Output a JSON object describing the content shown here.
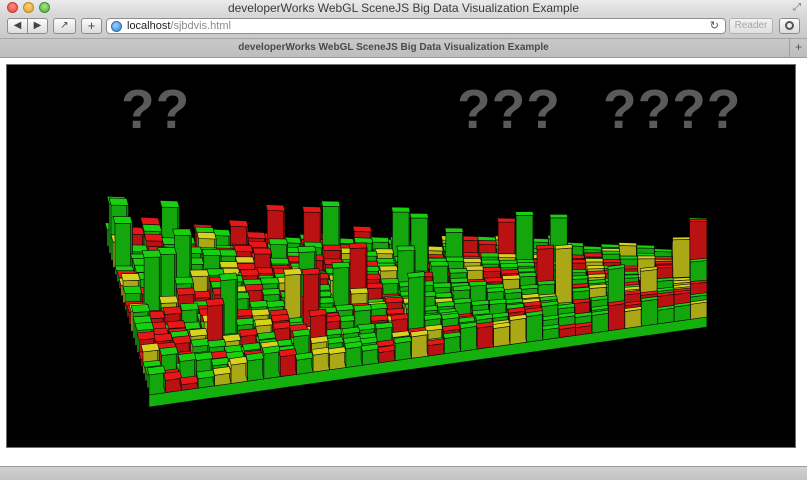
{
  "window": {
    "title": "developerWorks WebGL SceneJS Big Data Visualization Example"
  },
  "toolbar": {
    "back_icon": "◀",
    "forward_icon": "▶",
    "share_icon": "↗",
    "add_icon": "+",
    "url_host": "localhost",
    "url_path": "/sjbdvis.html",
    "reload_icon": "↻",
    "reader_label": "Reader"
  },
  "tab": {
    "label": "developerWorks WebGL SceneJS Big Data Visualization Example",
    "newtab_icon": "+"
  },
  "visualization": {
    "labels": [
      "??",
      "???",
      "????"
    ],
    "colors": {
      "background": "#000000",
      "green": "#18d010",
      "yellow": "#d6d21e",
      "red": "#e81616",
      "edge": "#0a0a0a"
    }
  }
}
